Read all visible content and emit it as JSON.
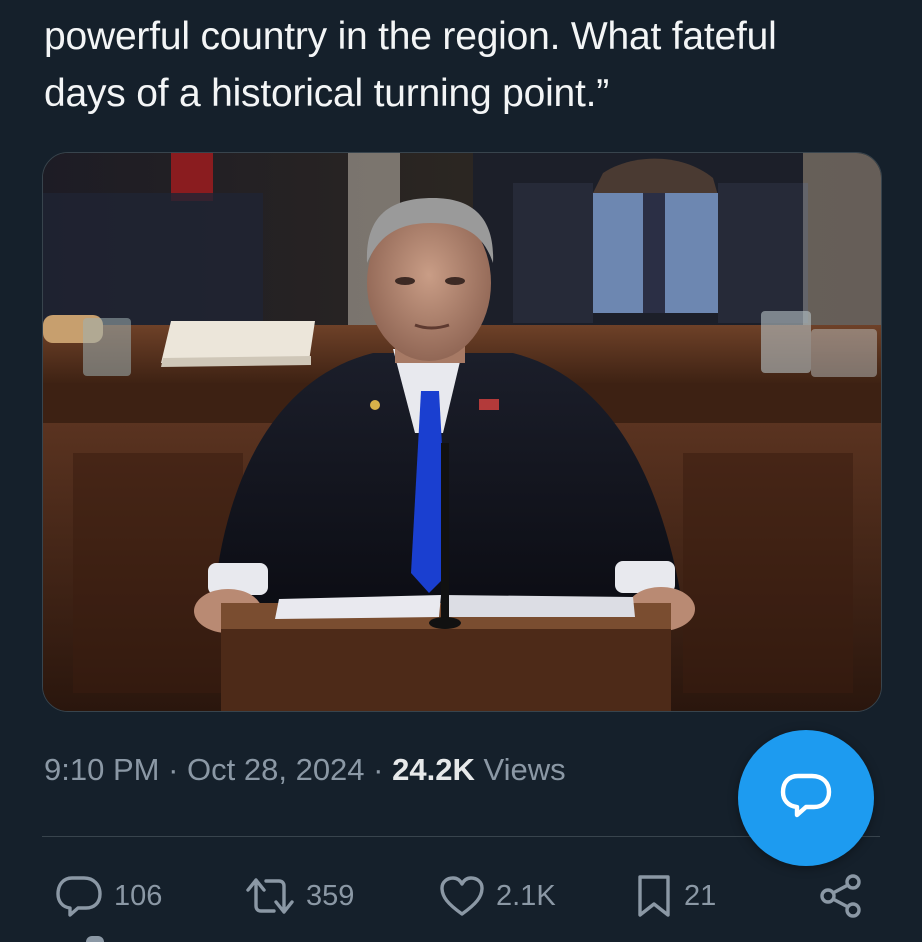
{
  "tweet": {
    "text_lines": [
      "powerful country in the region. What fateful",
      "days of a historical turning point.”"
    ],
    "media": {
      "icons": [
        "photo"
      ]
    },
    "meta": {
      "time": "9:10 PM",
      "separator": "·",
      "date": "Oct 28, 2024",
      "views_count": "24.2K",
      "views_label": "Views"
    }
  },
  "actions": {
    "reply": {
      "icon": "reply-icon",
      "count": "106"
    },
    "retweet": {
      "icon": "retweet-icon",
      "count": "359"
    },
    "like": {
      "icon": "heart-icon",
      "count": "2.1K"
    },
    "bookmark": {
      "icon": "bookmark-icon",
      "count": "21"
    },
    "share": {
      "icon": "share-icon"
    }
  },
  "fab": {
    "icon": "compose-reply-icon"
  },
  "colors": {
    "background": "#15202b",
    "text_primary": "#e7e9ea",
    "text_secondary": "#8b98a5",
    "divider": "#38444d",
    "accent": "#1d9bf0"
  }
}
